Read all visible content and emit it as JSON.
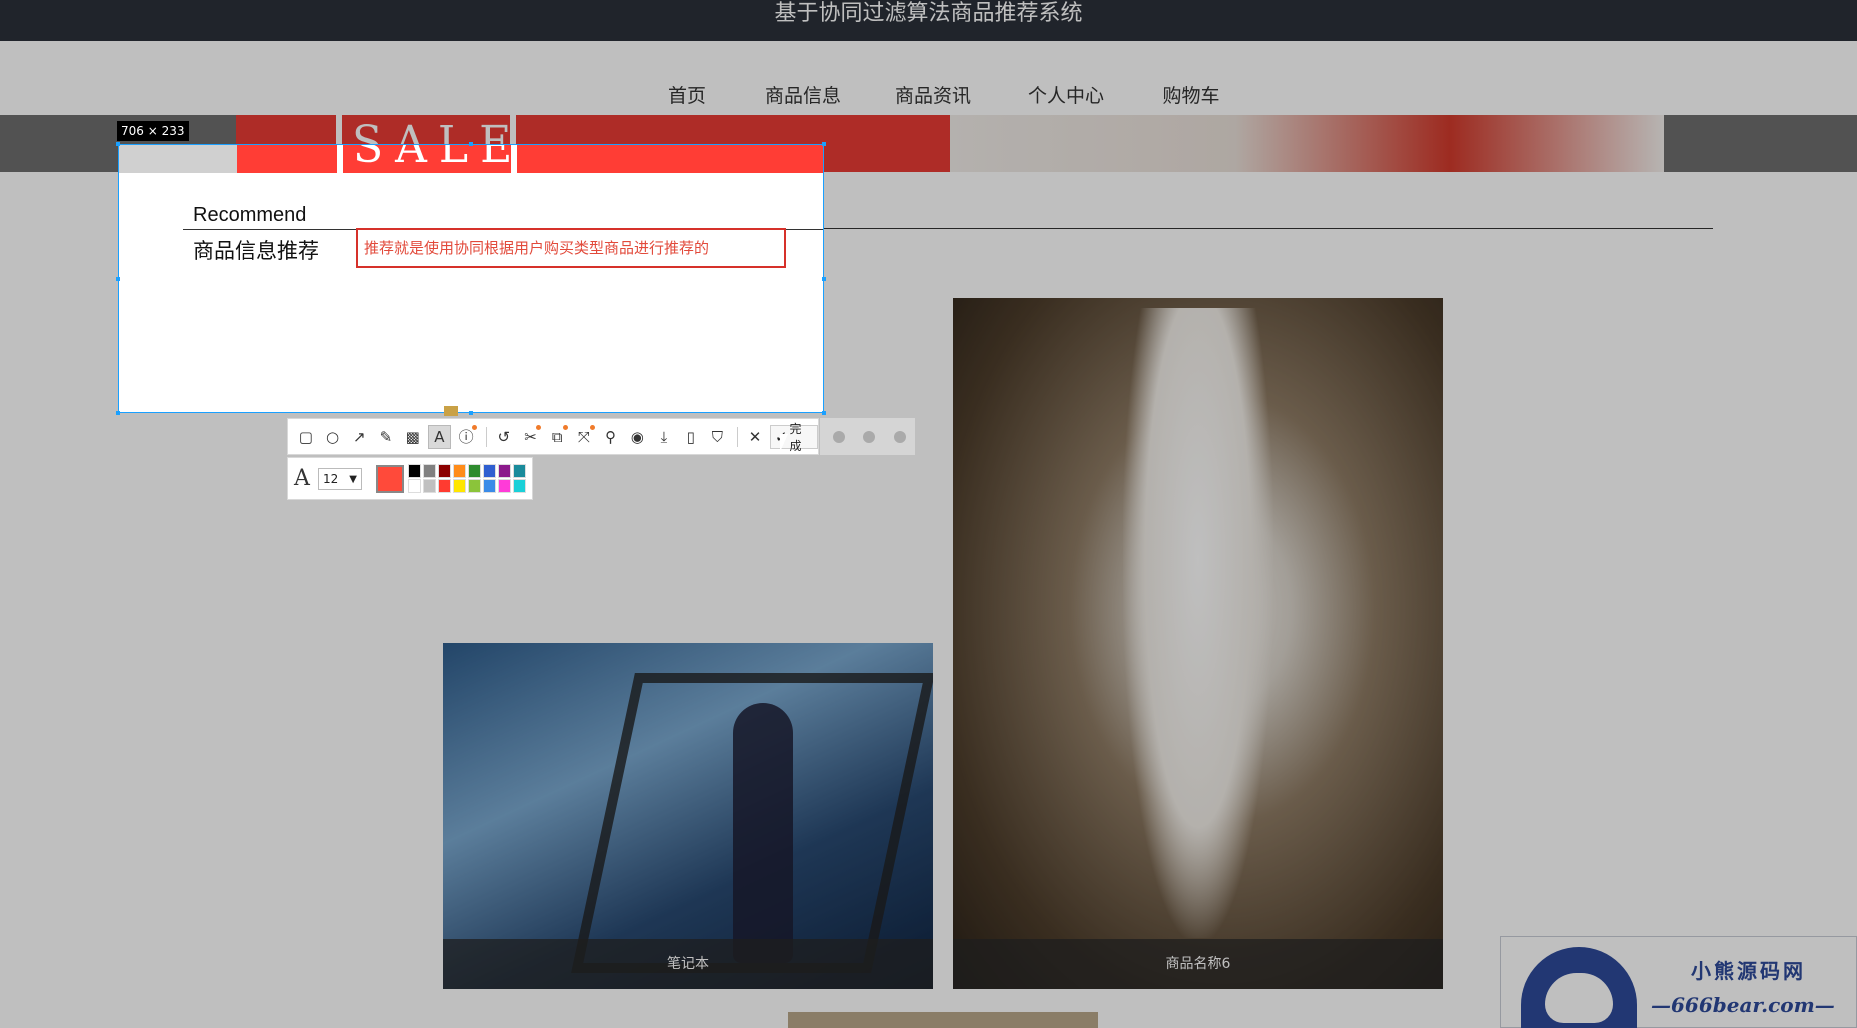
{
  "site": {
    "title": "基于协同过滤算法商品推荐系统"
  },
  "nav": {
    "items": [
      {
        "label": "首页",
        "active": true
      },
      {
        "label": "商品信息",
        "active": false
      },
      {
        "label": "商品资讯",
        "active": false
      },
      {
        "label": "个人中心",
        "active": false
      },
      {
        "label": "购物车",
        "active": false
      }
    ]
  },
  "banner": {
    "text": "SALE"
  },
  "cards": [
    {
      "caption": "笔记本"
    },
    {
      "caption": "商品名称6"
    }
  ],
  "watermark": {
    "brand": "小熊源码网",
    "url": "—666bear.com—"
  },
  "selection": {
    "size_label": "706 × 233",
    "recommend_en": "Recommend",
    "recommend_cn": "商品信息推荐",
    "annotation_text": "推荐就是使用协同根据用户购买类型商品进行推荐的"
  },
  "toolbar": {
    "tools": [
      "rectangle-icon",
      "ellipse-icon",
      "arrow-icon",
      "pencil-icon",
      "mosaic-icon",
      "text-icon",
      "number-icon",
      "undo-icon",
      "cut-icon",
      "ocr-icon",
      "scroll-capture-icon",
      "pin-icon",
      "record-icon",
      "download-icon",
      "phone-icon",
      "bookmark-icon"
    ],
    "cancel_icon": "close-icon",
    "done_label": "完成"
  },
  "subbar": {
    "font_icon": "font-size-icon",
    "font_size": "12",
    "current_color": "#ff4a3a",
    "palette": [
      "#000000",
      "#808080",
      "#8b0000",
      "#ff8c1a",
      "#2e8b2e",
      "#2f5fd0",
      "#8b1a8b",
      "#1a8b9b",
      "#ffffff",
      "#c0c0c0",
      "#ff3b30",
      "#ffe600",
      "#8bc43a",
      "#3a8be8",
      "#ff3bd8",
      "#1ad0d8"
    ]
  },
  "colors": {
    "accent": "#c9a146",
    "selection_border": "#1aa0ff",
    "annotation_red": "#d6312a"
  }
}
